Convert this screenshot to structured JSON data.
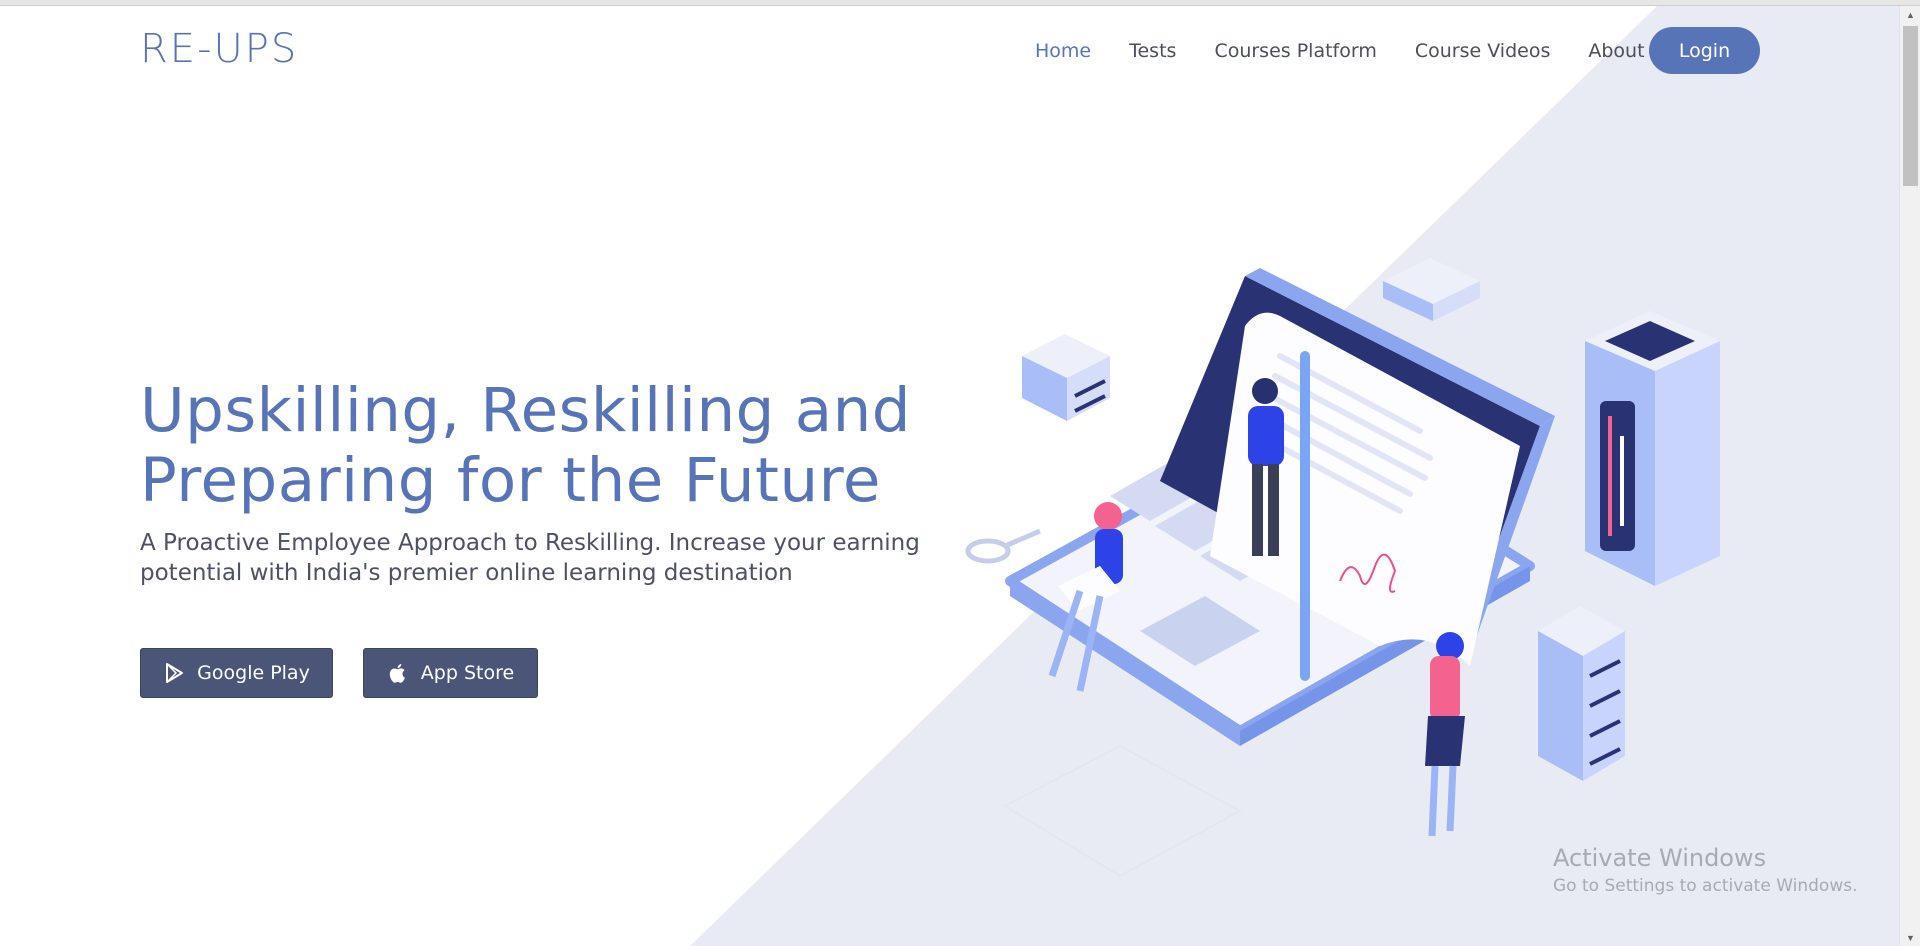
{
  "brand": "RE-UPS",
  "nav": {
    "items": [
      {
        "label": "Home",
        "active": true
      },
      {
        "label": "Tests",
        "active": false
      },
      {
        "label": "Courses Platform",
        "active": false
      },
      {
        "label": "Course Videos",
        "active": false
      },
      {
        "label": "About",
        "active": false
      }
    ],
    "login_label": "Login"
  },
  "hero": {
    "title_line1": "Upskilling, Reskilling and",
    "title_line2": "Preparing for the Future",
    "subtitle": "A Proactive Employee Approach to Reskilling. Increase your earning potential with India's premier online learning destination",
    "buttons": {
      "google_play": "Google Play",
      "app_store": "App Store"
    }
  },
  "watermark": {
    "title": "Activate Windows",
    "subtitle": "Go to Settings to activate Windows."
  },
  "colors": {
    "accent": "#5874b8",
    "button_dark": "#4a5578",
    "diagonal_bg": "#e8ebf4"
  },
  "icons": [
    "google-play-icon",
    "apple-icon",
    "scroll-up-arrow-icon",
    "scroll-down-arrow-icon"
  ]
}
